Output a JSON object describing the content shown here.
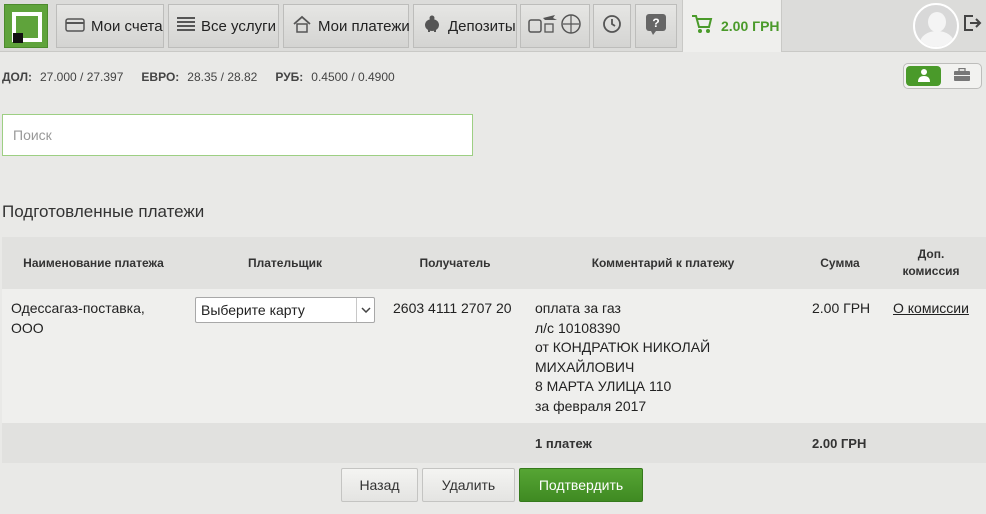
{
  "nav": {
    "accounts": "Мои счета",
    "services": "Все услуги",
    "payments": "Мои платежи",
    "deposits": "Депозиты",
    "cart_total": "2.00 ГРН"
  },
  "rates": {
    "usd_label": "ДОЛ:",
    "usd_value": "27.000 / 27.397",
    "eur_label": "ЕВРО:",
    "eur_value": "28.35 / 28.82",
    "rub_label": "РУБ:",
    "rub_value": "0.4500 / 0.4900"
  },
  "search": {
    "placeholder": "Поиск"
  },
  "heading": "Подготовленные платежи",
  "table": {
    "headers": {
      "name": "Наименование платежа",
      "payer": "Плательщик",
      "recipient": "Получатель",
      "comment": "Комментарий к платежу",
      "amount": "Сумма",
      "commission_line1": "Доп.",
      "commission_line2": "комиссия"
    },
    "row": {
      "name_line1": "Одессагаз-поставка,",
      "name_line2": "ООО",
      "payer_select": "Выберите карту",
      "recipient": "2603 4111 2707 20",
      "comment_lines": [
        "оплата за газ",
        "л/с 10108390",
        "от КОНДРАТЮК НИКОЛАЙ",
        "МИХАЙЛОВИЧ",
        "8 МАРТА УЛИЦА 110",
        "за февраля 2017"
      ],
      "amount": "2.00 ГРН",
      "commission_link": "О комиссии"
    },
    "total": {
      "count": "1 платеж",
      "amount": "2.00 ГРН"
    }
  },
  "buttons": {
    "back": "Назад",
    "delete": "Удалить",
    "confirm": "Подтвердить"
  }
}
